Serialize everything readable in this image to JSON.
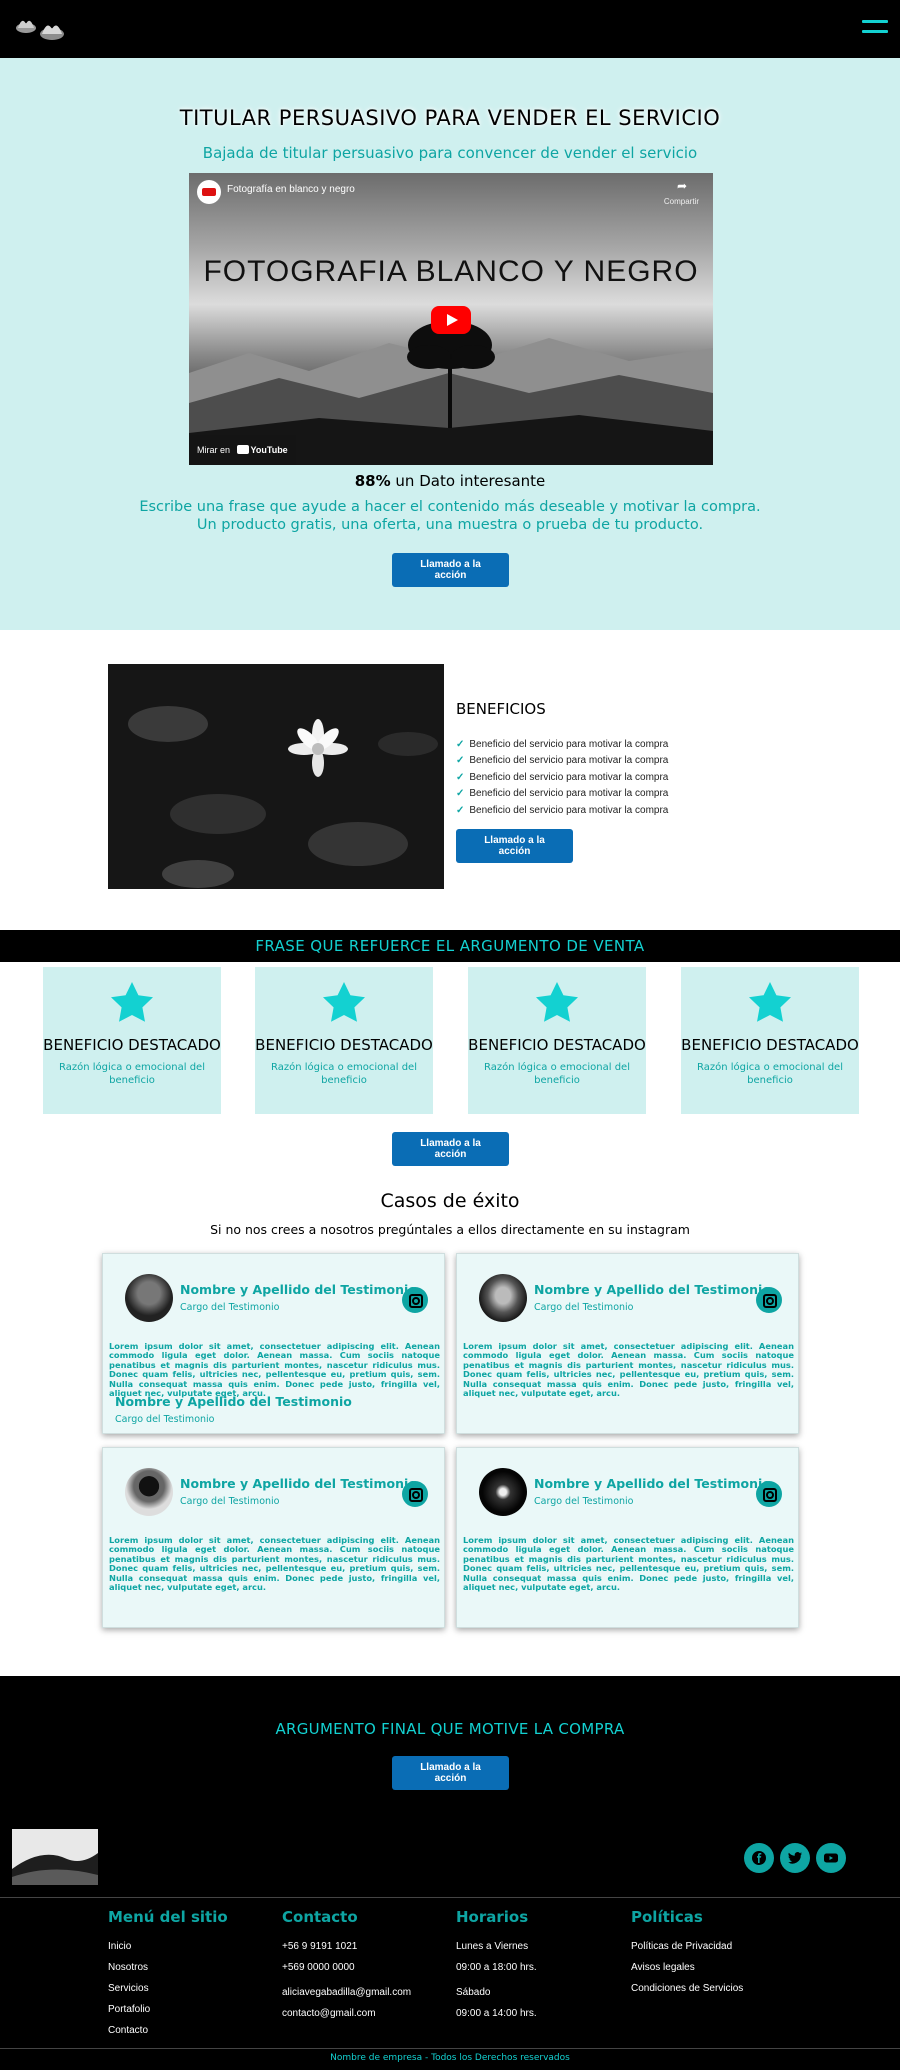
{
  "header": {
    "logo_icon": "lotus-logo-icon",
    "menu_icon": "hamburger-icon",
    "accent": "#13d1d1"
  },
  "hero": {
    "title": "TITULAR PERSUASIVO PARA VENDER EL SERVICIO",
    "subtitle": "Bajada de titular persuasivo para convencer de vender el servicio",
    "video": {
      "title": "Fotografía en blanco y negro",
      "share": "Compartir",
      "overlay_text": "FOTOGRAFIA  BLANCO  Y NEGRO",
      "watch_on": "Mirar en",
      "youtube": "YouTube"
    },
    "data_bold": "88%",
    "data_rest": " un Dato interesante",
    "desc_line1": "Escribe una frase que ayude a hacer el contenido más deseable y motivar la compra.",
    "desc_line2": "Un producto gratis, una oferta, una muestra o prueba de tu producto.",
    "cta": "Llamado a la acción"
  },
  "benefits": {
    "title": "BENEFICIOS",
    "items": [
      "Beneficio del servicio para motivar la compra",
      "Beneficio del servicio para motivar la compra",
      "Beneficio del servicio para motivar la compra",
      "Beneficio del servicio para motivar la compra",
      "Beneficio del servicio para motivar la compra"
    ],
    "cta": "Llamado a la acción"
  },
  "band": {
    "text": "FRASE QUE REFUERCE EL ARGUMENTO DE VENTA"
  },
  "features": [
    {
      "title": "BENEFICIO DESTACADO",
      "subtitle": "Razón lógica o emocional del beneficio"
    },
    {
      "title": "BENEFICIO DESTACADO",
      "subtitle": "Razón lógica o emocional del beneficio"
    },
    {
      "title": "BENEFICIO DESTACADO",
      "subtitle": "Razón lógica o emocional del beneficio"
    },
    {
      "title": "BENEFICIO DESTACADO",
      "subtitle": "Razón lógica o emocional del beneficio"
    }
  ],
  "features_cta": "Llamado a la acción",
  "cases": {
    "title": "Casos de éxito",
    "subtitle": "Si no nos crees a nosotros pregúntales a ellos directamente en su instagram",
    "items": [
      {
        "name": "Nombre y Apellido del Testimonio",
        "role": "Cargo del Testimonio",
        "text": "Lorem ipsum dolor sit amet, consectetuer adipiscing elit. Aenean commodo ligula eget dolor. Aenean massa. Cum sociis natoque penatibus et magnis dis parturient montes, nascetur ridiculus mus. Donec quam felis, ultricies nec, pellentesque eu, pretium quis, sem. Nulla consequat massa quis enim. Donec pede justo, fringilla vel, aliquet nec, vulputate eget, arcu.",
        "name2": "Nombre y Apellido del Testimonio",
        "role2": "Cargo del Testimonio"
      },
      {
        "name": "Nombre y Apellido del Testimonio",
        "role": "Cargo del Testimonio",
        "text": "Lorem ipsum dolor sit amet, consectetuer adipiscing elit. Aenean commodo ligula eget dolor. Aenean massa. Cum sociis natoque penatibus et magnis dis parturient montes, nascetur ridiculus mus. Donec quam felis, ultricies nec, pellentesque eu, pretium quis, sem. Nulla consequat massa quis enim. Donec pede justo, fringilla vel, aliquet nec, vulputate eget, arcu."
      },
      {
        "name": "Nombre y Apellido del Testimonio",
        "role": "Cargo del Testimonio",
        "text": "Lorem ipsum dolor sit amet, consectetuer adipiscing elit. Aenean commodo ligula eget dolor. Aenean massa. Cum sociis natoque penatibus et magnis dis parturient montes, nascetur ridiculus mus. Donec quam felis, ultricies nec, pellentesque eu, pretium quis, sem. Nulla consequat massa quis enim. Donec pede justo, fringilla vel, aliquet nec, vulputate eget, arcu."
      },
      {
        "name": "Nombre y Apellido del Testimonio",
        "role": "Cargo del Testimonio",
        "text": "Lorem ipsum dolor sit amet, consectetuer adipiscing elit. Aenean commodo ligula eget dolor. Aenean massa. Cum sociis natoque penatibus et magnis dis parturient montes, nascetur ridiculus mus. Donec quam felis, ultricies nec, pellentesque eu, pretium quis, sem. Nulla consequat massa quis enim. Donec pede justo, fringilla vel, aliquet nec, vulputate eget, arcu."
      }
    ]
  },
  "final": {
    "title": "ARGUMENTO FINAL QUE MOTIVE LA COMPRA",
    "cta": "Llamado a la acción"
  },
  "social": {
    "icons": [
      "facebook-icon",
      "twitter-icon",
      "youtube-icon"
    ]
  },
  "footer": {
    "menu": {
      "title": "Menú del sitio",
      "items": [
        "Inicio",
        "Nosotros",
        "Servicios",
        "Portafolio",
        "Contacto"
      ]
    },
    "contact": {
      "title": "Contacto",
      "phone1": "+56 9 9191 1021",
      "phone2": "+569 0000 0000",
      "email1": "aliciavegabadilla@gmail.com",
      "email2": "contacto@gmail.com"
    },
    "hours": {
      "title": "Horarios",
      "weekdays": "Lunes a Viernes",
      "weekdays_time": "09:00 a 18:00 hrs.",
      "saturday": "Sábado",
      "saturday_time": "09:00 a 14:00 hrs."
    },
    "policies": {
      "title": "Políticas",
      "items": [
        "Políticas de Privacidad",
        "Avisos legales",
        "Condiciones de Servicios"
      ]
    },
    "copyright": "Nombre de empresa - Todos los Derechos reservados"
  }
}
